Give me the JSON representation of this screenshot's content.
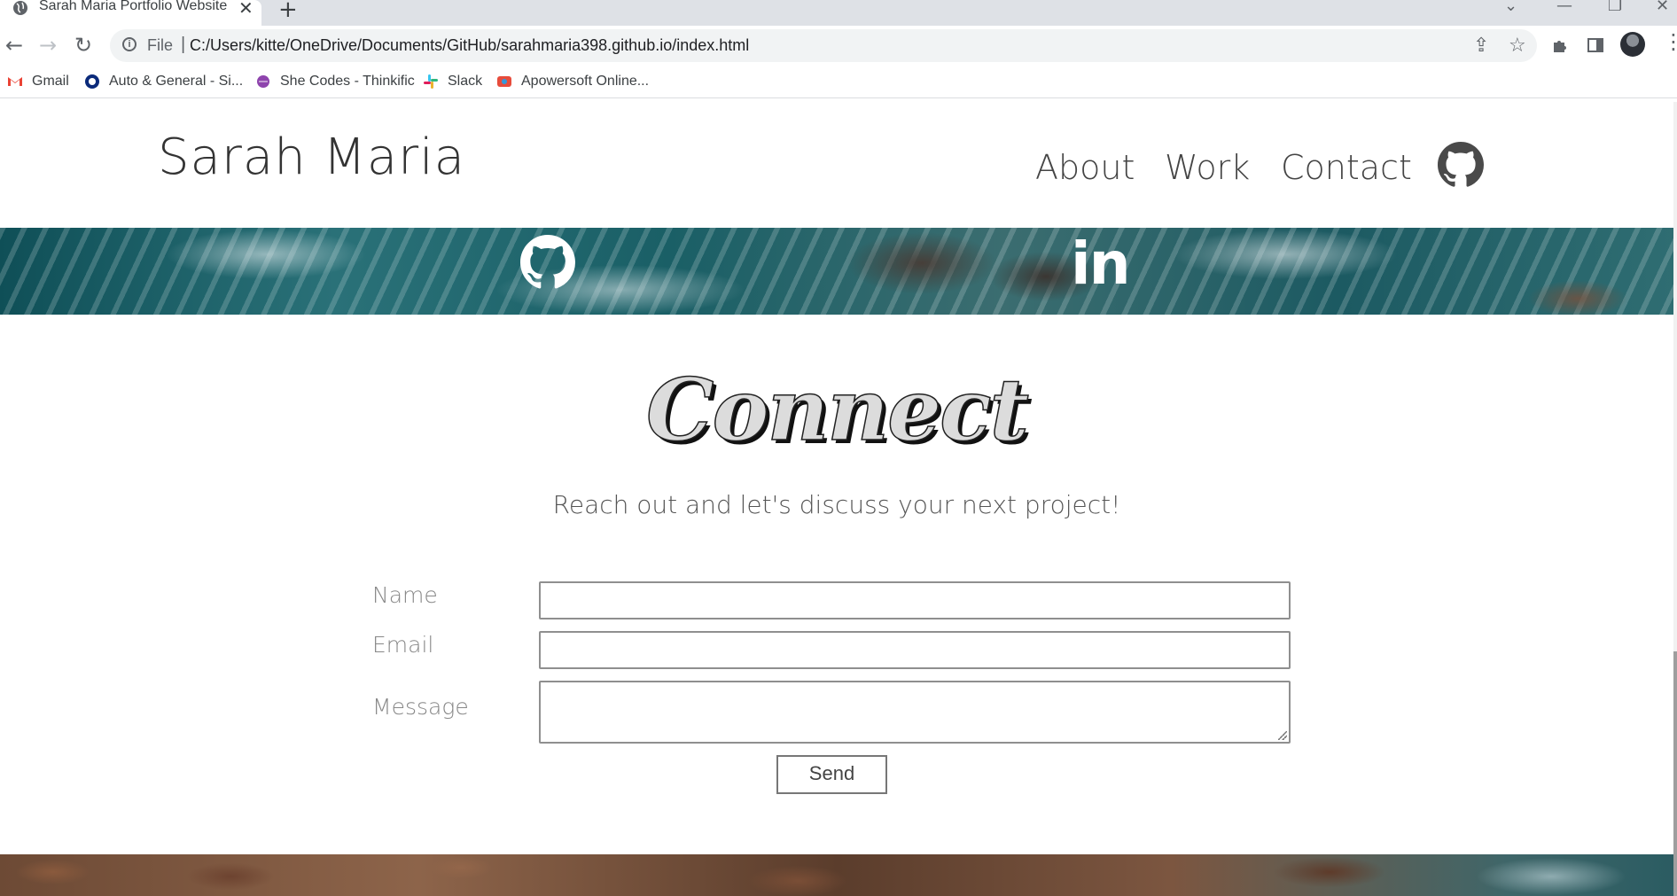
{
  "browser": {
    "tab_title": "Sarah Maria Portfolio Website",
    "tab_close": "✕",
    "new_tab": "+",
    "url_scheme": "File",
    "url_separator": "|",
    "url": "C:/Users/kitte/OneDrive/Documents/GitHub/sarahmaria398.github.io/index.html",
    "bookmarks": [
      {
        "label": "Gmail",
        "icon": "gmail-icon"
      },
      {
        "label": "Auto & General - Si...",
        "icon": "auto-general-icon"
      },
      {
        "label": "She Codes - Thinkific",
        "icon": "shecodes-icon"
      },
      {
        "label": "Slack",
        "icon": "slack-icon"
      },
      {
        "label": "Apowersoft Online...",
        "icon": "apowersoft-icon"
      }
    ]
  },
  "site": {
    "brand": "Sarah Maria",
    "nav": [
      {
        "label": "About"
      },
      {
        "label": "Work"
      },
      {
        "label": "Contact"
      }
    ],
    "nav_icon": "github-icon"
  },
  "social": {
    "github_icon": "github-icon",
    "linkedin_label": "in"
  },
  "contact": {
    "title": "Connect",
    "subtitle": "Reach out and let's discuss your next project!",
    "fields": [
      {
        "label": "Name",
        "value": ""
      },
      {
        "label": "Email",
        "value": ""
      },
      {
        "label": "Message",
        "value": ""
      }
    ],
    "send_label": "Send"
  },
  "colors": {
    "title_fill": "#dcdcdc",
    "text_gray": "#888888",
    "ocean": "#1a5f66"
  }
}
